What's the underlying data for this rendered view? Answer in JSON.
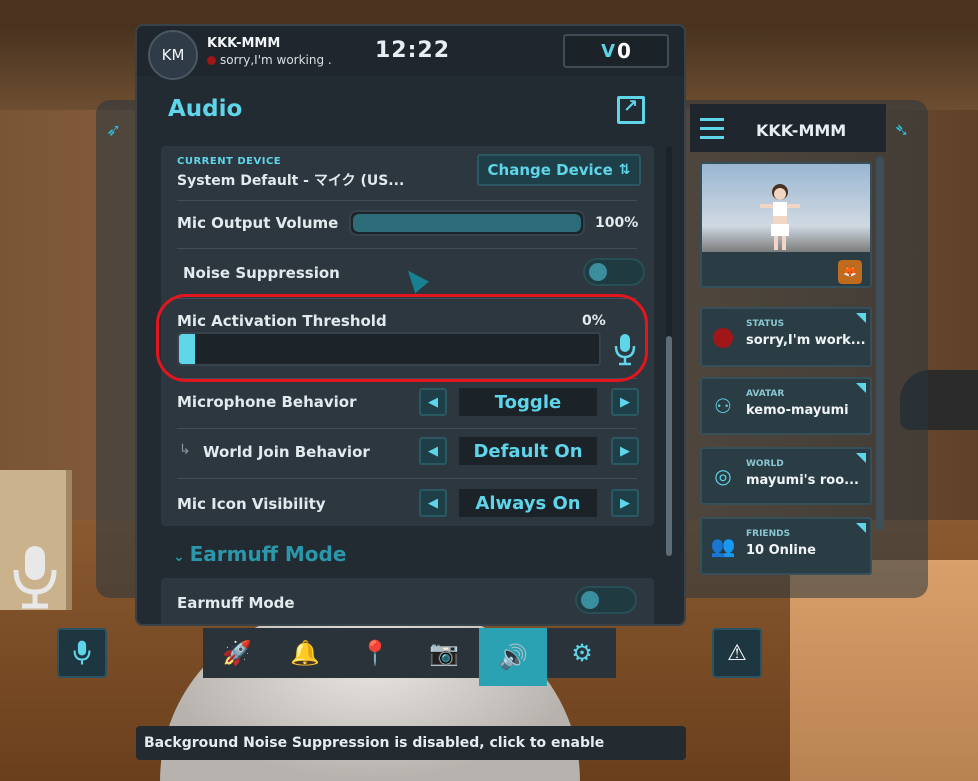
{
  "header": {
    "avatar_initials": "KM",
    "user_name": "KKK-MMM",
    "status_text": "sorry,I'm working .",
    "status_color": "#a11616",
    "clock": "12:22",
    "currency_value": "0",
    "currency_icon": "vrc-credit-icon"
  },
  "audio": {
    "title": "Audio",
    "device_caption": "CURRENT DEVICE",
    "device_name": "System Default - マイク (US...",
    "change_device_label": "Change Device",
    "mic_output_volume_label": "Mic Output Volume",
    "mic_output_volume_value": "100%",
    "mic_output_volume_level": 1.0,
    "noise_suppression_label": "Noise Suppression",
    "noise_suppression_on": false,
    "mic_threshold_label": "Mic Activation Threshold",
    "mic_threshold_value": "0%",
    "mic_threshold_level": 0.0,
    "mic_behavior_label": "Microphone Behavior",
    "mic_behavior_value": "Toggle",
    "world_join_label": "World Join Behavior",
    "world_join_value": "Default On",
    "mic_icon_visibility_label": "Mic Icon Visibility",
    "mic_icon_visibility_value": "Always On",
    "earmuff_section_title": "Earmuff Mode",
    "earmuff_mode_label": "Earmuff Mode",
    "earmuff_mode_on": false
  },
  "quick_menu": {
    "user_name": "KKK-MMM",
    "cards": [
      {
        "caption": "STATUS",
        "value": "sorry,I'm work...",
        "icon": "status-dot-icon"
      },
      {
        "caption": "AVATAR",
        "value": "kemo-mayumi",
        "icon": "avatar-icon"
      },
      {
        "caption": "WORLD",
        "value": "mayumi's roo...",
        "icon": "world-icon"
      },
      {
        "caption": "FRIENDS",
        "value": "10 Online",
        "icon": "friends-icon"
      }
    ]
  },
  "dock": {
    "items": [
      "launch-pad-icon",
      "notifications-icon",
      "location-icon",
      "camera-icon",
      "audio-icon",
      "settings-icon"
    ],
    "active_item": "audio-icon"
  },
  "toast": {
    "text": "Background Noise Suppression is disabled, click to enable"
  },
  "colors": {
    "accent": "#5fd5ea",
    "panel_bg": "#222a32",
    "row_bg": "#2d3740",
    "annotation_ring": "#e3151d"
  }
}
